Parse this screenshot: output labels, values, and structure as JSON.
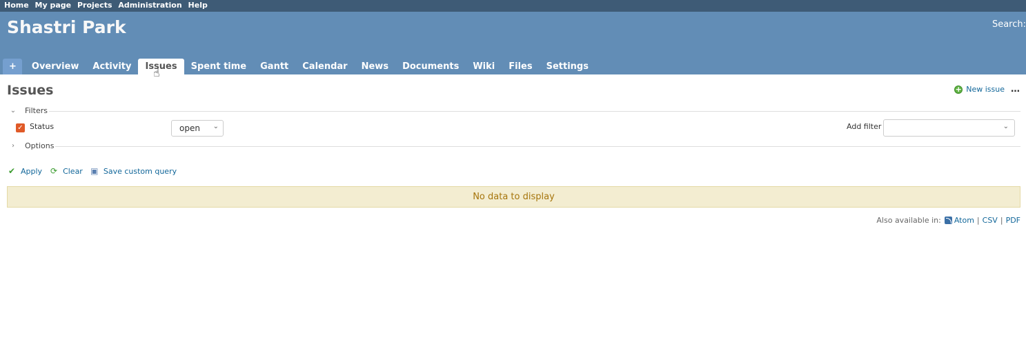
{
  "top_menu": {
    "items": [
      "Home",
      "My page",
      "Projects",
      "Administration",
      "Help"
    ]
  },
  "header": {
    "project_title": "Shastri Park",
    "search_label": "Search:"
  },
  "tabs": {
    "new_object": "+",
    "items": [
      "Overview",
      "Activity",
      "Issues",
      "Spent time",
      "Gantt",
      "Calendar",
      "News",
      "Documents",
      "Wiki",
      "Files",
      "Settings"
    ],
    "selected": "Issues"
  },
  "page": {
    "title": "Issues",
    "new_issue": "New issue",
    "more_actions": "…"
  },
  "filters": {
    "legend": "Filters",
    "status_label": "Status",
    "status_checked": true,
    "status_operator": "open",
    "add_filter_label": "Add filter",
    "add_filter_value": ""
  },
  "options": {
    "legend": "Options"
  },
  "actions": {
    "apply": "Apply",
    "clear": "Clear",
    "save": "Save custom query"
  },
  "results": {
    "no_data": "No data to display"
  },
  "other_formats": {
    "label": "Also available in:",
    "atom": "Atom",
    "csv": "CSV",
    "pdf": "PDF"
  },
  "colors": {
    "top_menu_bg": "#3e5b76",
    "header_bg": "#628db6",
    "link": "#116699",
    "nodata_bg": "#f3edd1",
    "checkbox": "#e05a28"
  }
}
